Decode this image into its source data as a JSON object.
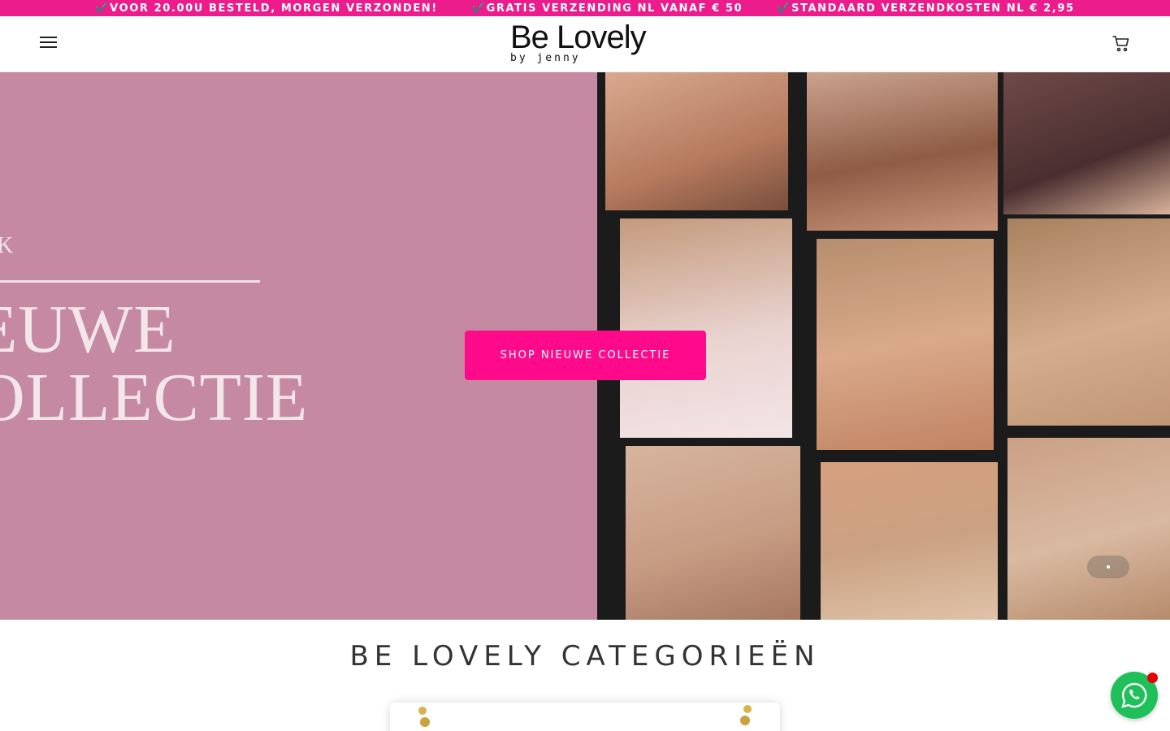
{
  "announcement": {
    "messages": [
      "✔️VOOR 20.00U BESTELD, MORGEN VERZONDEN!",
      "✔️GRATIS VERZENDING NL VANAF € 50",
      "✔️STANDAARD VERZENDKOSTEN NL € 2,95"
    ],
    "background": "#ec1c8c"
  },
  "header": {
    "logo_main": "Be Lovely",
    "logo_sub": "by jenny",
    "menu_icon": "hamburger-icon",
    "cart_icon": "cart-icon"
  },
  "hero": {
    "overlay_letter": "K",
    "headline_line1": "EUWE",
    "headline_line2": "OLLECTIE",
    "cta_label": "SHOP NIEUWE COLLECTIE",
    "cta_color": "#ff0a8a",
    "left_panel_color": "#c58aa1"
  },
  "categories": {
    "heading": "BE LOVELY CATEGORIEËN"
  },
  "whatsapp": {
    "icon": "whatsapp-icon",
    "color": "#1fc059"
  }
}
